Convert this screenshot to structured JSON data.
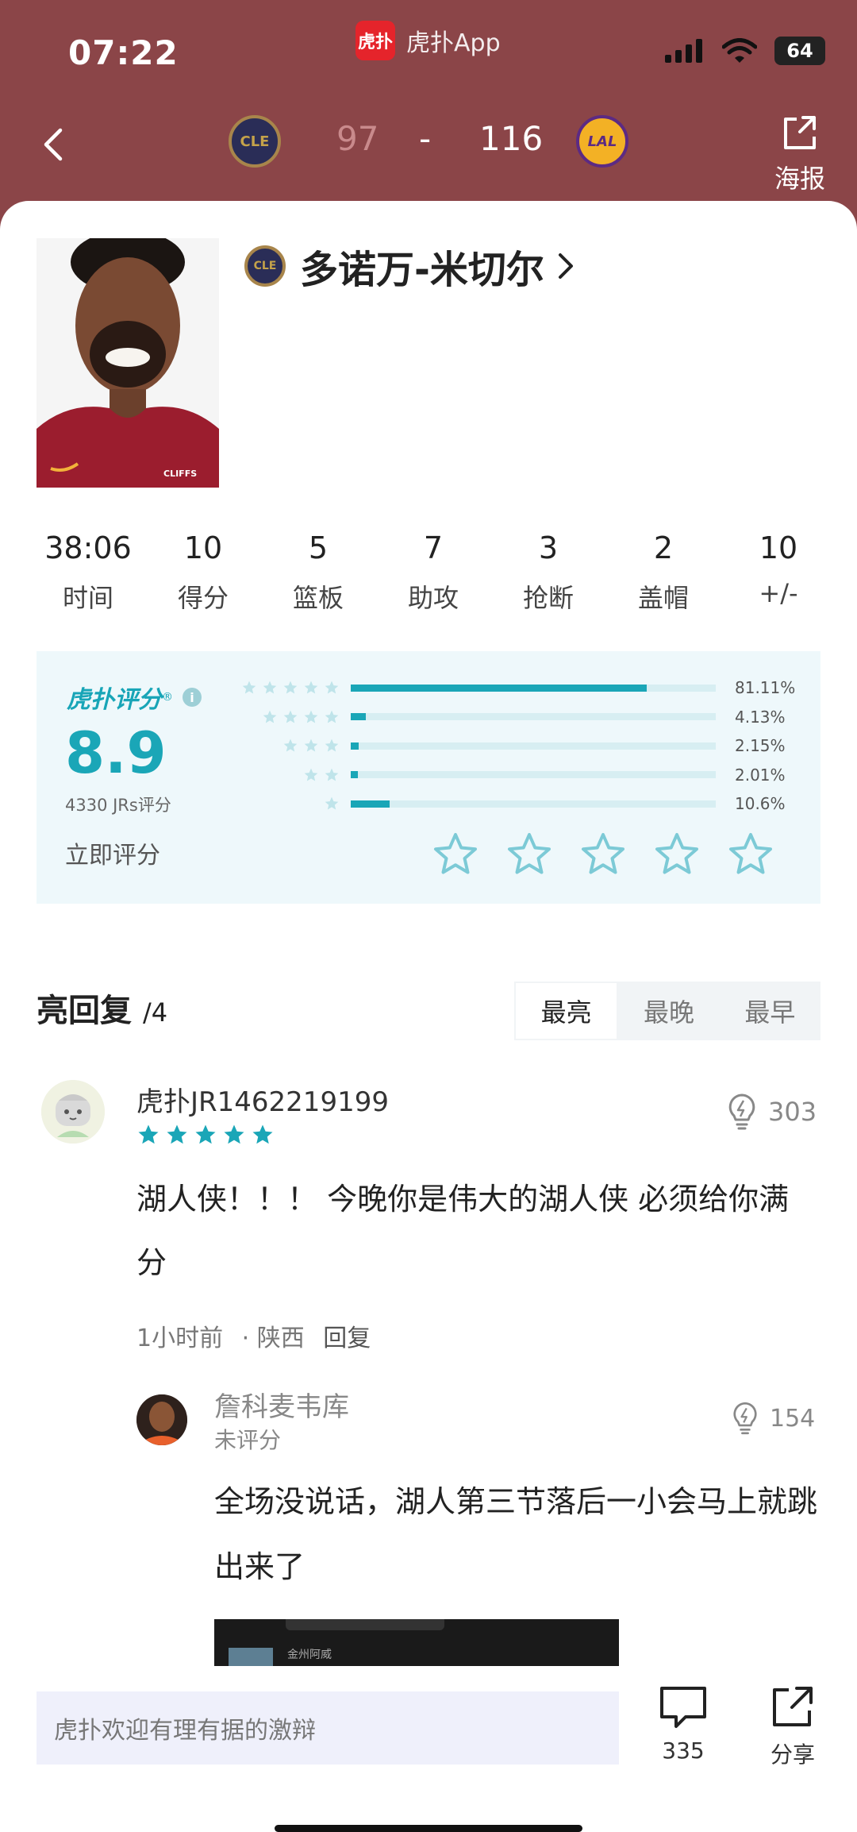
{
  "status_bar": {
    "time": "07:22",
    "app_name": "虎扑App",
    "app_logo_text": "虎扑",
    "battery": "64"
  },
  "header": {
    "home_team_abbr": "CLE",
    "away_team_abbr": "LAL",
    "home_score": "97",
    "dash": "-",
    "away_score": "116",
    "poster_label": "海报"
  },
  "player": {
    "name": "多诺万-米切尔",
    "team_abbr": "CLE",
    "jersey_text": "CLIFFS"
  },
  "stats": [
    {
      "value": "38:06",
      "label": "时间"
    },
    {
      "value": "10",
      "label": "得分"
    },
    {
      "value": "5",
      "label": "篮板"
    },
    {
      "value": "7",
      "label": "助攻"
    },
    {
      "value": "3",
      "label": "抢断"
    },
    {
      "value": "2",
      "label": "盖帽"
    },
    {
      "value": "10",
      "label": "+/-"
    }
  ],
  "rating": {
    "brand": "虎扑评分",
    "brand_mark": "®",
    "score": "8.9",
    "count": "4330 JRs评分",
    "rate_now": "立即评分",
    "distribution": [
      {
        "stars": 5,
        "percent_text": "81.11%",
        "percent": 81.11
      },
      {
        "stars": 4,
        "percent_text": "4.13%",
        "percent": 4.13
      },
      {
        "stars": 3,
        "percent_text": "2.15%",
        "percent": 2.15
      },
      {
        "stars": 2,
        "percent_text": "2.01%",
        "percent": 2.01
      },
      {
        "stars": 1,
        "percent_text": "10.6%",
        "percent": 10.6
      }
    ],
    "accent_color": "#1aa6b7"
  },
  "replies": {
    "title": "亮回复",
    "count": "/4",
    "sort_tabs": [
      "最亮",
      "最晚",
      "最早"
    ],
    "active_sort": "最亮"
  },
  "comment": {
    "user": "虎扑JR1462219199",
    "stars": 5,
    "likes": "303",
    "text": "湖人侠！！！ 今晚你是伟大的湖人侠 必须给你满分",
    "time": "1小时前",
    "location": "· 陕西",
    "reply": "回复"
  },
  "sub_comment": {
    "user": "詹科麦韦库",
    "rating": "未评分",
    "likes": "154",
    "text": "全场没说话，湖人第三节落后一小会马上就跳出来了",
    "image_caption": "金州阿威"
  },
  "bottom_bar": {
    "input_placeholder": "虎扑欢迎有理有据的激辩",
    "comment_count": "335",
    "share_label": "分享"
  },
  "colors": {
    "header_bg": "#8b4548",
    "accent": "#1aa6b7",
    "brand_red": "#e5242b"
  }
}
